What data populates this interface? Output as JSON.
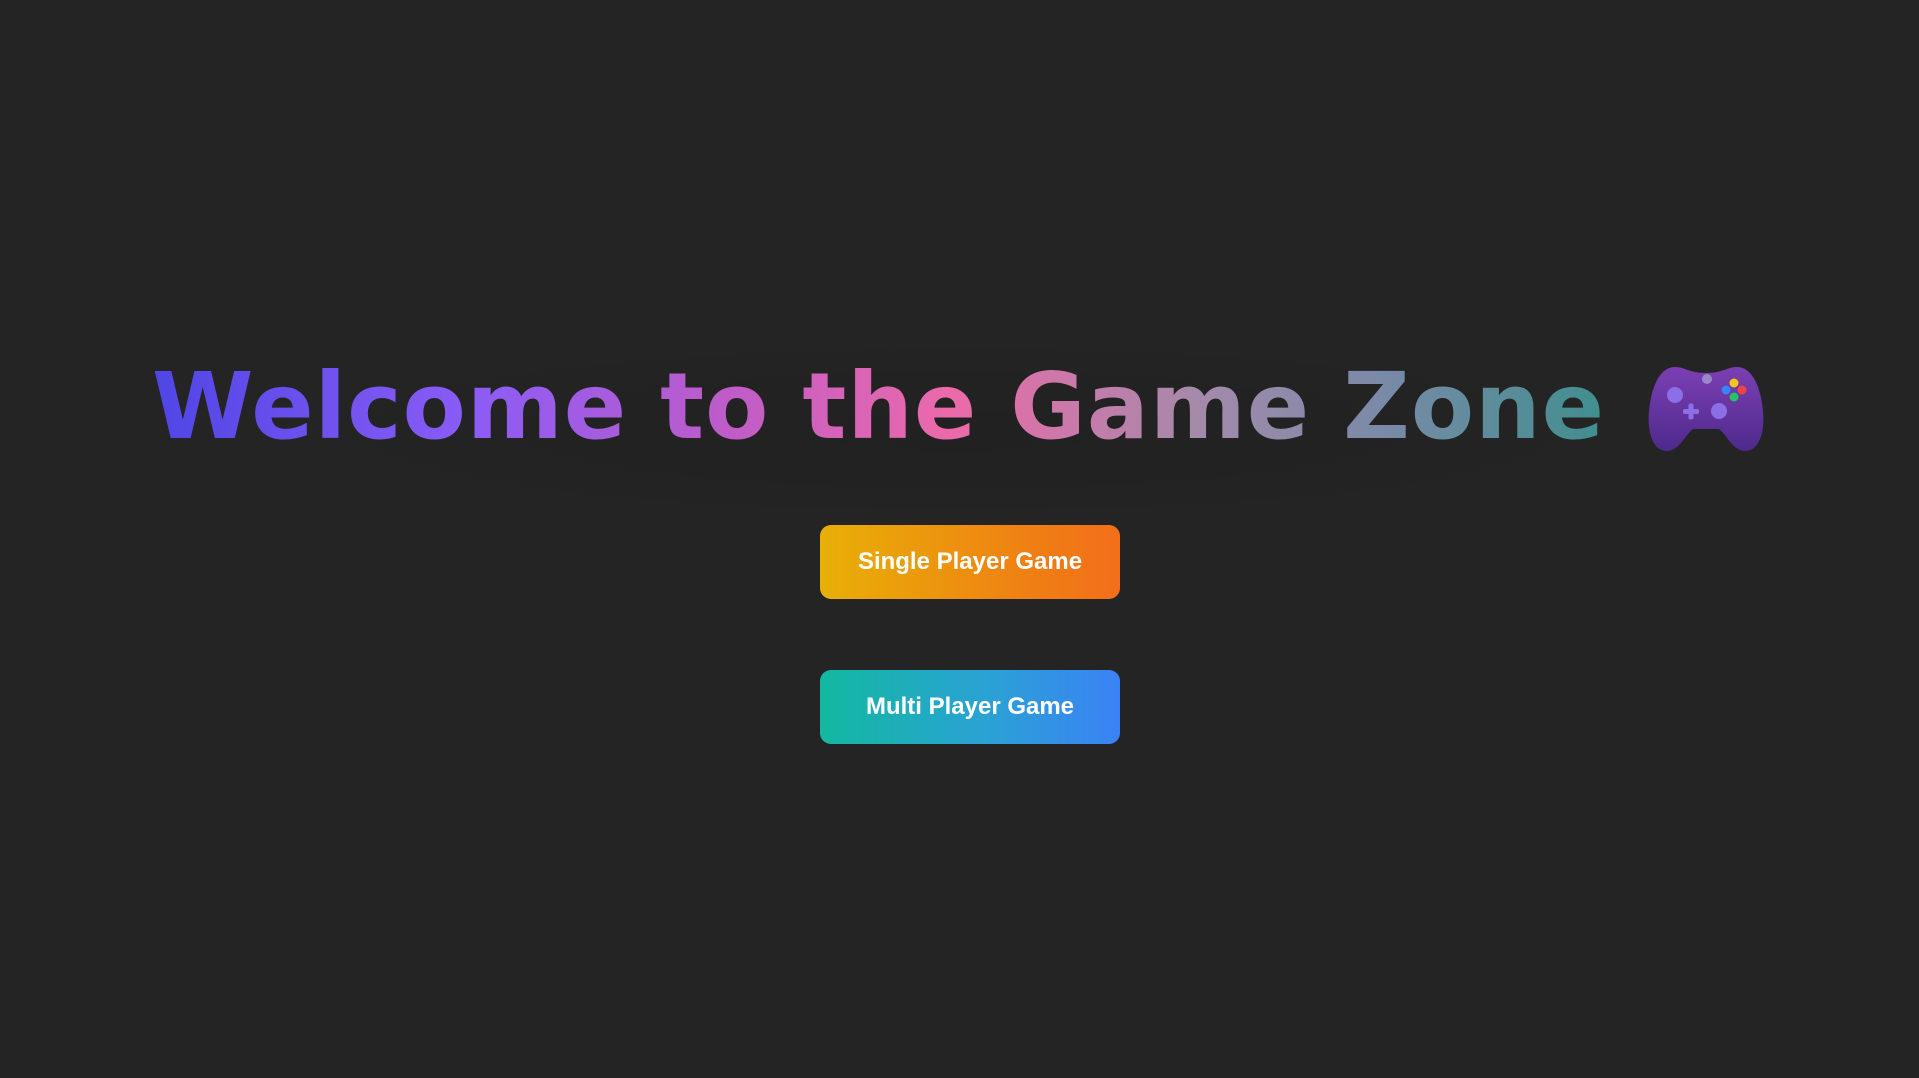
{
  "page": {
    "title": "Welcome to the Game Zone",
    "background_color": "#242424"
  },
  "icons": {
    "title_icon": "game-controller-icon"
  },
  "buttons": {
    "single_player_label": "Single Player Game",
    "multi_player_label": "Multi Player Game",
    "single_player_colors": [
      "#e8b007",
      "#f26f1b"
    ],
    "multi_player_colors": [
      "#12b8a0",
      "#3b82f6"
    ]
  }
}
